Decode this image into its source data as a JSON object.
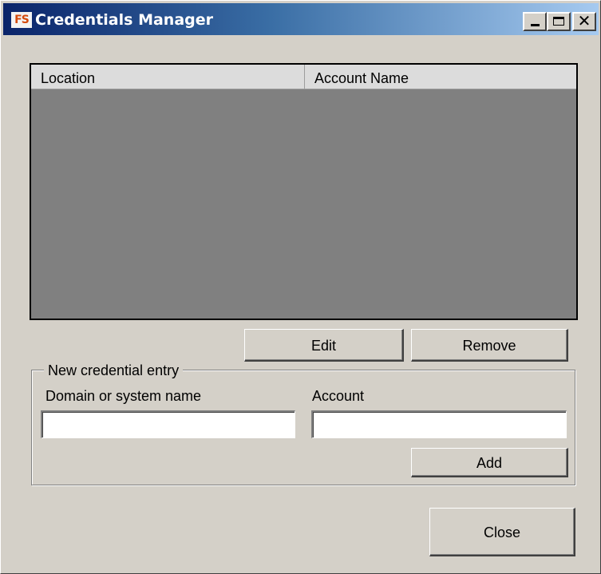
{
  "window": {
    "title": "Credentials Manager",
    "icon_text": "FS",
    "caption_buttons": {
      "minimize_icon": "minimize-icon",
      "maximize_icon": "maximize-icon",
      "close_glyph": "✕"
    }
  },
  "list": {
    "columns": [
      "Location",
      "Account Name"
    ],
    "rows": []
  },
  "buttons": {
    "edit": "Edit",
    "remove": "Remove",
    "add": "Add",
    "close": "Close"
  },
  "new_entry": {
    "group_label": "New credential entry",
    "domain_label": "Domain or system name",
    "domain_value": "",
    "account_label": "Account",
    "account_value": ""
  },
  "colors": {
    "face": "#d4d0c8",
    "list_background": "#808080",
    "title_gradient_start": "#0a246a",
    "title_gradient_end": "#a6caf0"
  }
}
